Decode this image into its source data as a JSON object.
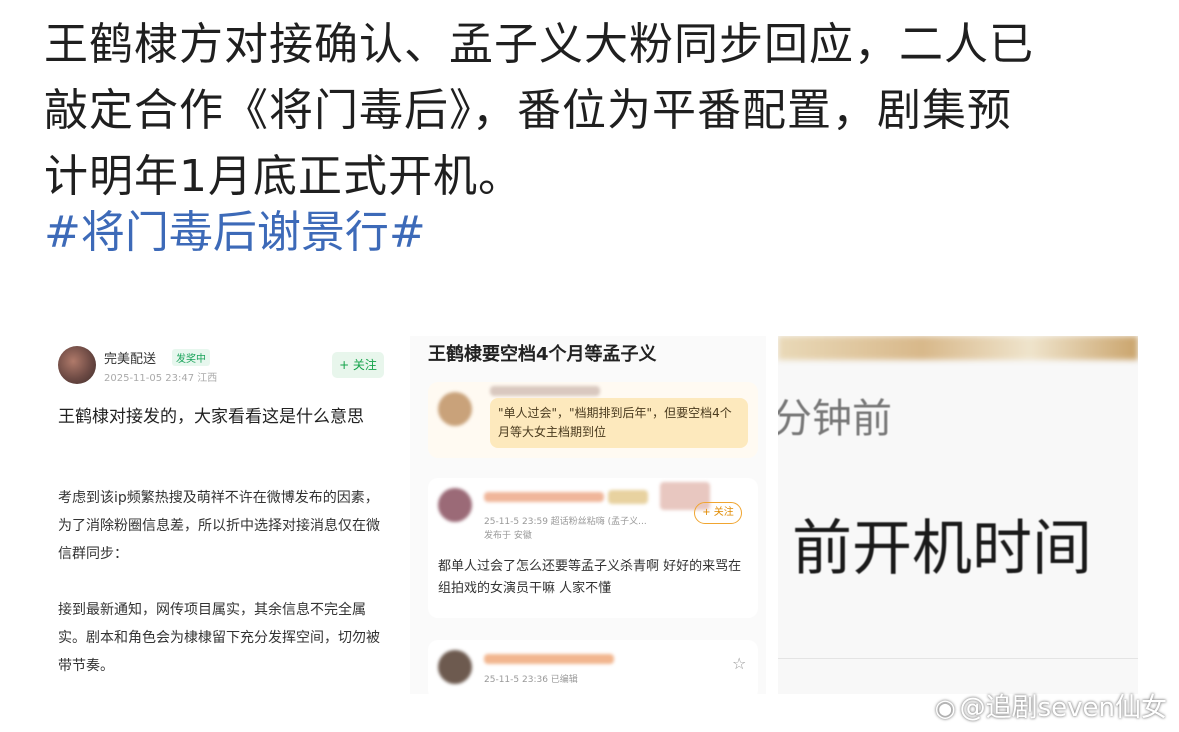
{
  "post": {
    "lines": [
      "王鹤棣方对接确认、孟子义大粉同步回应，二人已",
      "敲定合作《将门毒后》，番位为平番配置，剧集预",
      "计明年1月底正式开机。"
    ],
    "hashtag": "#将门毒后谢景行#"
  },
  "panel1": {
    "username": "完美配送",
    "badge": "发奖中",
    "meta": "2025-11-05 23:47 江西",
    "follow": "+ 关注",
    "title": "王鹤棣对接发的，大家看看这是什么意思",
    "para1": "考虑到该ip频繁热搜及萌祥不许在微博发布的因素，为了消除粉圈信息差，所以折中选择对接消息仅在微信群同步：",
    "para2": "接到最新通知，网传项目属实，其余信息不完全属实。剧本和角色会为棣棣留下充分发挥空间，切勿被带节奏。"
  },
  "panel2": {
    "title": "王鹤棣要空档4个月等孟子义",
    "bubble": "\"单人过会\"，\"档期排到后年\"，但要空档4个月等大女主档期到位",
    "card2_meta": "25-11-5 23:59  超话粉丝粘嗨 (孟子义...",
    "card2_meta2": "发布于 安徽",
    "card2_follow": "+ 关注",
    "comment": "都单人过会了怎么还要等孟子义杀青啊 好好的来骂在组拍戏的女演员干嘛 人家不懂",
    "card3_meta": "25-11-5 23:36  已编辑",
    "star": "☆"
  },
  "panel3": {
    "ago": "分钟前",
    "big": "前开机时间"
  },
  "watermark": {
    "logo": "◉",
    "text": "@追剧seven仙女"
  }
}
